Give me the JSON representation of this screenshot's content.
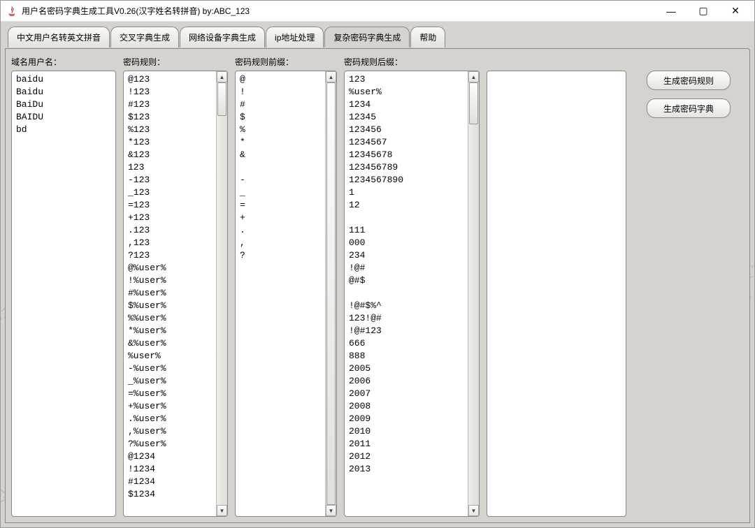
{
  "window": {
    "title": "用户名密码字典生成工具V0.26(汉字姓名转拼音) by:ABC_123"
  },
  "tabs": [
    "中文用户名转英文拼音",
    "交叉字典生成",
    "网络设备字典生成",
    "ip地址处理",
    "复杂密码字典生成",
    "帮助"
  ],
  "active_tab_index": 4,
  "columns": {
    "domain_users": {
      "label": "域名用户名：",
      "items": [
        "baidu",
        "Baidu",
        "BaiDu",
        "BAIDU",
        "bd"
      ]
    },
    "password_rules": {
      "label": "密码规则：",
      "items": [
        "@123",
        "!123",
        "#123",
        "$123",
        "%123",
        "*123",
        "&123",
        "123",
        "-123",
        "_123",
        "=123",
        "+123",
        ".123",
        ",123",
        "?123",
        "@%user%",
        "!%user%",
        "#%user%",
        "$%user%",
        "%%user%",
        "*%user%",
        "&%user%",
        "%user%",
        "-%user%",
        "_%user%",
        "=%user%",
        "+%user%",
        ".%user%",
        ",%user%",
        "?%user%",
        "@1234",
        "!1234",
        "#1234",
        "$1234"
      ]
    },
    "prefixes": {
      "label": "密码规则前缀：",
      "items": [
        "@",
        "!",
        "#",
        "$",
        "%",
        "*",
        "&",
        "",
        "-",
        "_",
        "=",
        "+",
        ".",
        ",",
        "?"
      ]
    },
    "suffixes": {
      "label": "密码规则后缀：",
      "items": [
        "123",
        "%user%",
        "1234",
        "12345",
        "123456",
        "1234567",
        "12345678",
        "123456789",
        "1234567890",
        "1",
        "12",
        "",
        "111",
        "000",
        "234",
        "!@#",
        "@#$",
        "",
        "!@#$%^",
        "123!@#",
        "!@#123",
        "666",
        "888",
        "2005",
        "2006",
        "2007",
        "2008",
        "2009",
        "2010",
        "2011",
        "2012",
        "2013"
      ]
    },
    "output": {
      "label": ""
    }
  },
  "buttons": {
    "gen_rules": "生成密码规则",
    "gen_dict": "生成密码字典"
  },
  "watermark": {
    "line1": "公众号\"希潭实验室\"",
    "line2": "(ABC_123原创)",
    "brand": "希潭实验室"
  }
}
